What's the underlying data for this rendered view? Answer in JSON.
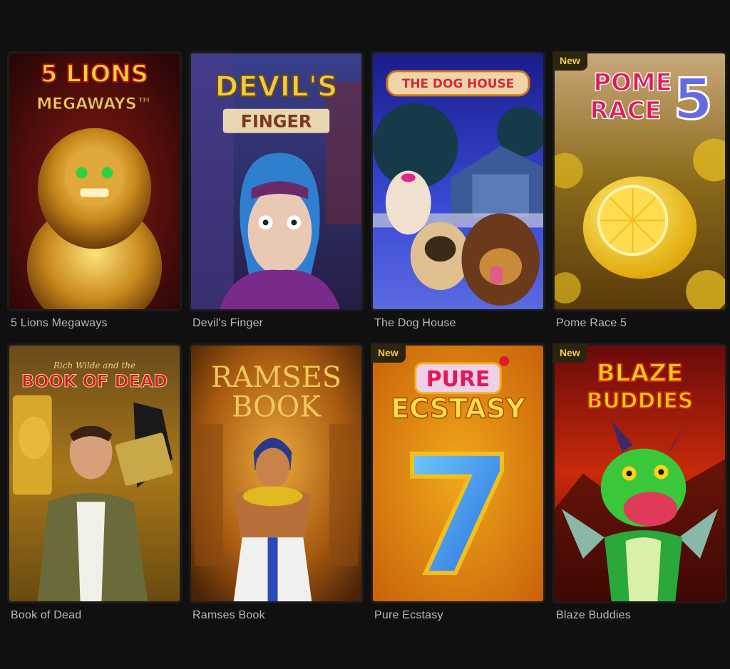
{
  "games": [
    {
      "title": "5 Lions Megaways",
      "art_title_line1": "5 LIONS",
      "art_title_line2": "MEGAWAYS™",
      "badge": ""
    },
    {
      "title": "Devil's Finger",
      "art_title_line1": "DEVIL'S",
      "art_title_line2": "FINGER",
      "badge": ""
    },
    {
      "title": "The Dog House",
      "art_title_line1": "THE DOG HOUSE",
      "art_title_line2": "",
      "badge": ""
    },
    {
      "title": "Pome Race 5",
      "art_title_line1": "POME",
      "art_title_line2": "RACE",
      "art_title_number": "5",
      "badge": "New"
    },
    {
      "title": "Book of Dead",
      "art_title_line1": "Rich Wilde and the",
      "art_title_line2": "BOOK OF DEAD",
      "badge": ""
    },
    {
      "title": "Ramses Book",
      "art_title_line1": "RAMSES",
      "art_title_line2": "BOOK",
      "badge": ""
    },
    {
      "title": "Pure Ecstasy",
      "art_title_line1": "PURE",
      "art_title_line2": "ECSTASY",
      "art_title_number": "7",
      "badge": "New"
    },
    {
      "title": "Blaze Buddies",
      "art_title_line1": "BLAZE",
      "art_title_line2": "BUDDIES",
      "badge": "New"
    }
  ],
  "colors": {
    "background": "#101010",
    "label": "#b8b8b8",
    "badge_bg": "#2a2410",
    "badge_text": "#f2c94c"
  }
}
